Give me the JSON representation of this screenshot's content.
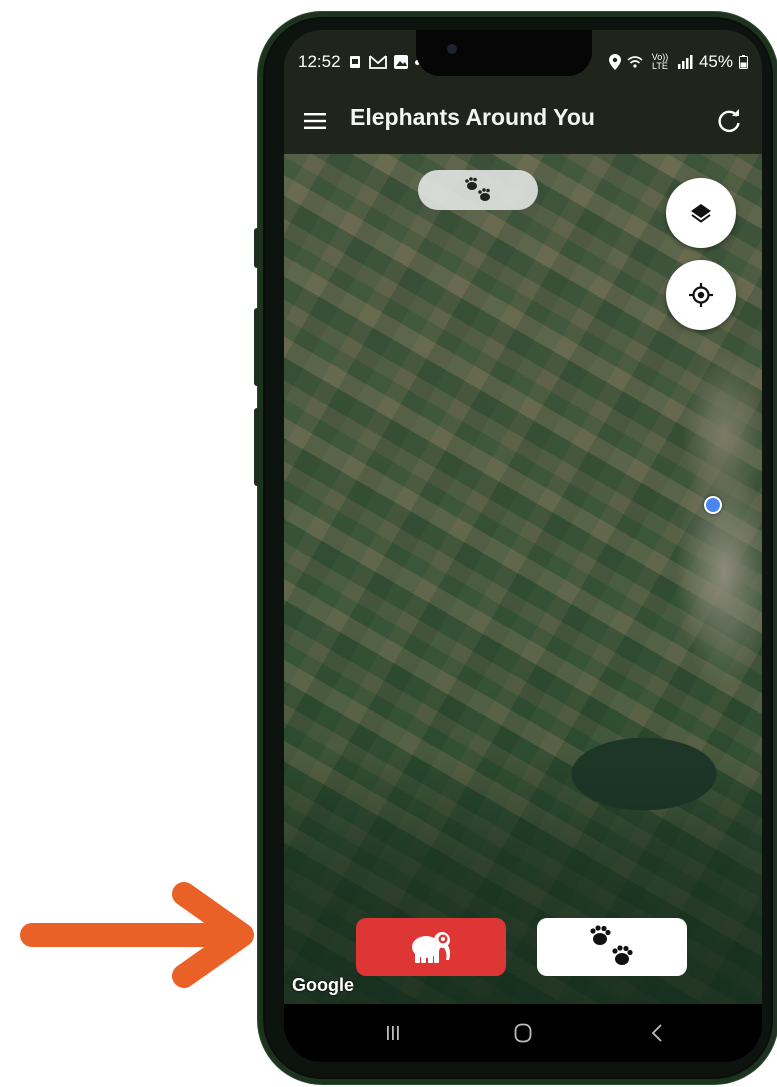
{
  "status_bar": {
    "time": "12:52",
    "battery": "45%",
    "network_label": "Vo)) LTE"
  },
  "app_bar": {
    "title": "Elephants Around You"
  },
  "map": {
    "attribution": "Google"
  },
  "colors": {
    "app_bar": "#1f251d",
    "elephant_button": "#de3535",
    "annotation_arrow": "#ea6128",
    "location_dot": "#4a86f0"
  },
  "icons": {
    "menu": "hamburger-icon",
    "refresh": "refresh-icon",
    "layers": "layers-icon",
    "locate": "my-location-icon",
    "elephant": "elephant-icon",
    "paws": "paw-prints-icon"
  }
}
